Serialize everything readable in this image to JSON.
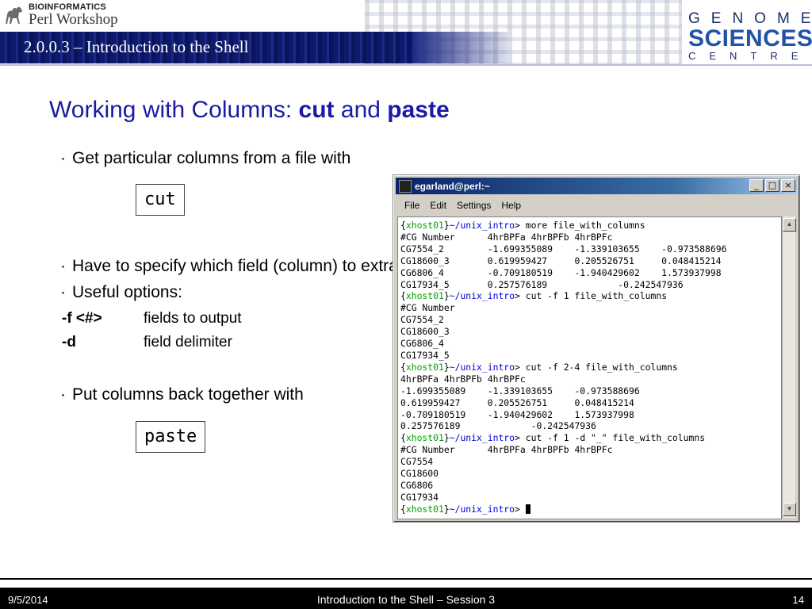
{
  "header": {
    "logo_top": "BIOINFORMATICS",
    "logo_bottom": "Perl Workshop",
    "section_title": "2.0.0.3 – Introduction to the Shell",
    "org_line1": "GENOME",
    "org_line2": "SCIENCES",
    "org_line3": "CENTRE"
  },
  "slide": {
    "title_prefix": "Working with Columns: ",
    "title_cmd1": "cut",
    "title_mid": " and ",
    "title_cmd2": "paste",
    "bullet1": "Get particular columns from a file with",
    "code1": "cut",
    "bullet2": "Have to specify which field (column) to extract",
    "bullet3": "Useful options:",
    "options": [
      {
        "key": "-f <#>",
        "desc": "fields to output"
      },
      {
        "key": "-d",
        "desc": "field delimiter"
      }
    ],
    "bullet4": "Put columns back together with",
    "code2": "paste"
  },
  "terminal": {
    "title": "egarland@perl:~",
    "menu": [
      "File",
      "Edit",
      "Settings",
      "Help"
    ],
    "prompt_host": "xhost01",
    "prompt_path": "~/unix_intro",
    "commands": [
      "more file_with_columns",
      "cut -f 1 file_with_columns",
      "cut -f 2-4 file_with_columns",
      "cut -f 1 -d \"_\" file_with_columns"
    ],
    "output1": [
      "#CG Number      4hrBPFa 4hrBPFb 4hrBPFc",
      "CG7554_2        -1.699355089    -1.339103655    -0.973588696",
      "CG18600_3       0.619959427     0.205526751     0.048415214",
      "CG6806_4        -0.709180519    -1.940429602    1.573937998",
      "CG17934_5       0.257576189             -0.242547936"
    ],
    "output2": [
      "#CG Number",
      "CG7554_2",
      "CG18600_3",
      "CG6806_4",
      "CG17934_5"
    ],
    "output3": [
      "4hrBPFa 4hrBPFb 4hrBPFc",
      "-1.699355089    -1.339103655    -0.973588696",
      "0.619959427     0.205526751     0.048415214",
      "-0.709180519    -1.940429602    1.573937998",
      "0.257576189             -0.242547936"
    ],
    "output4": [
      "#CG Number      4hrBPFa 4hrBPFb 4hrBPFc",
      "CG7554",
      "CG18600",
      "CG6806",
      "CG17934"
    ]
  },
  "footer": {
    "date": "9/5/2014",
    "center": "Introduction to the Shell – Session 3",
    "page": "14"
  }
}
